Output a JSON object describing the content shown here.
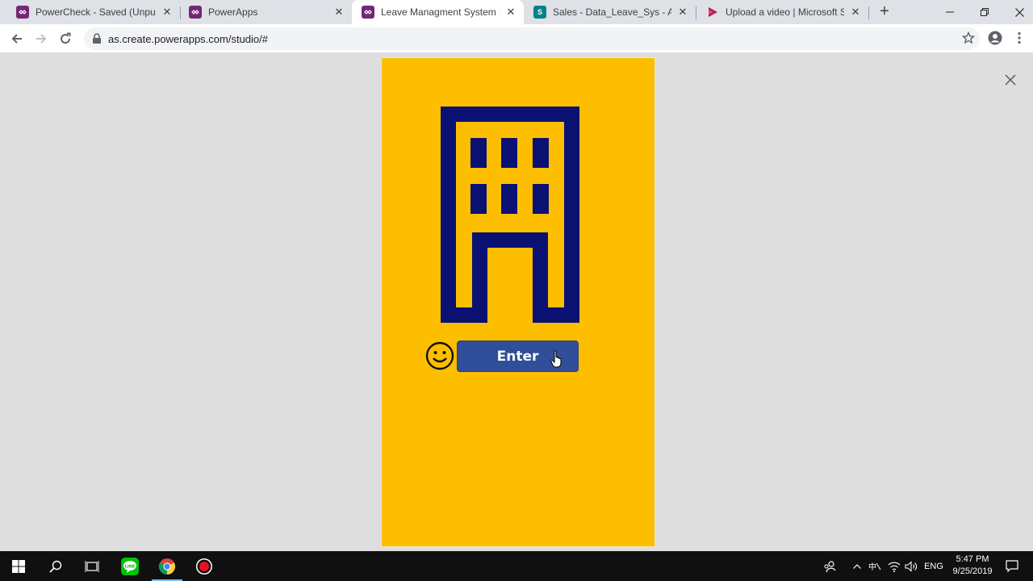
{
  "browser": {
    "tabs": [
      {
        "title": "PowerCheck - Saved (Unpublis",
        "favicon_color": "#742774",
        "favicon": "powerapps-icon"
      },
      {
        "title": "PowerApps",
        "favicon_color": "#742774",
        "favicon": "powerapps-icon"
      },
      {
        "title": "Leave Managment System - Po",
        "favicon_color": "#742774",
        "favicon": "powerapps-icon",
        "active": true
      },
      {
        "title": "Sales - Data_Leave_Sys - All Ite",
        "favicon_color": "#038387",
        "favicon_letter": "S",
        "favicon": "sharepoint-icon"
      },
      {
        "title": "Upload a video | Microsoft Stre",
        "favicon_color": "#bc1948",
        "favicon": "stream-icon"
      }
    ],
    "url": "as.create.powerapps.com/studio/#"
  },
  "app": {
    "background_color": "#fdbe00",
    "icon_color": "#0a1172",
    "enter_button": {
      "label": "Enter",
      "color": "#2f4f9a"
    }
  },
  "taskbar": {
    "language": "ENG",
    "time": "5:47 PM",
    "date": "9/25/2019"
  }
}
